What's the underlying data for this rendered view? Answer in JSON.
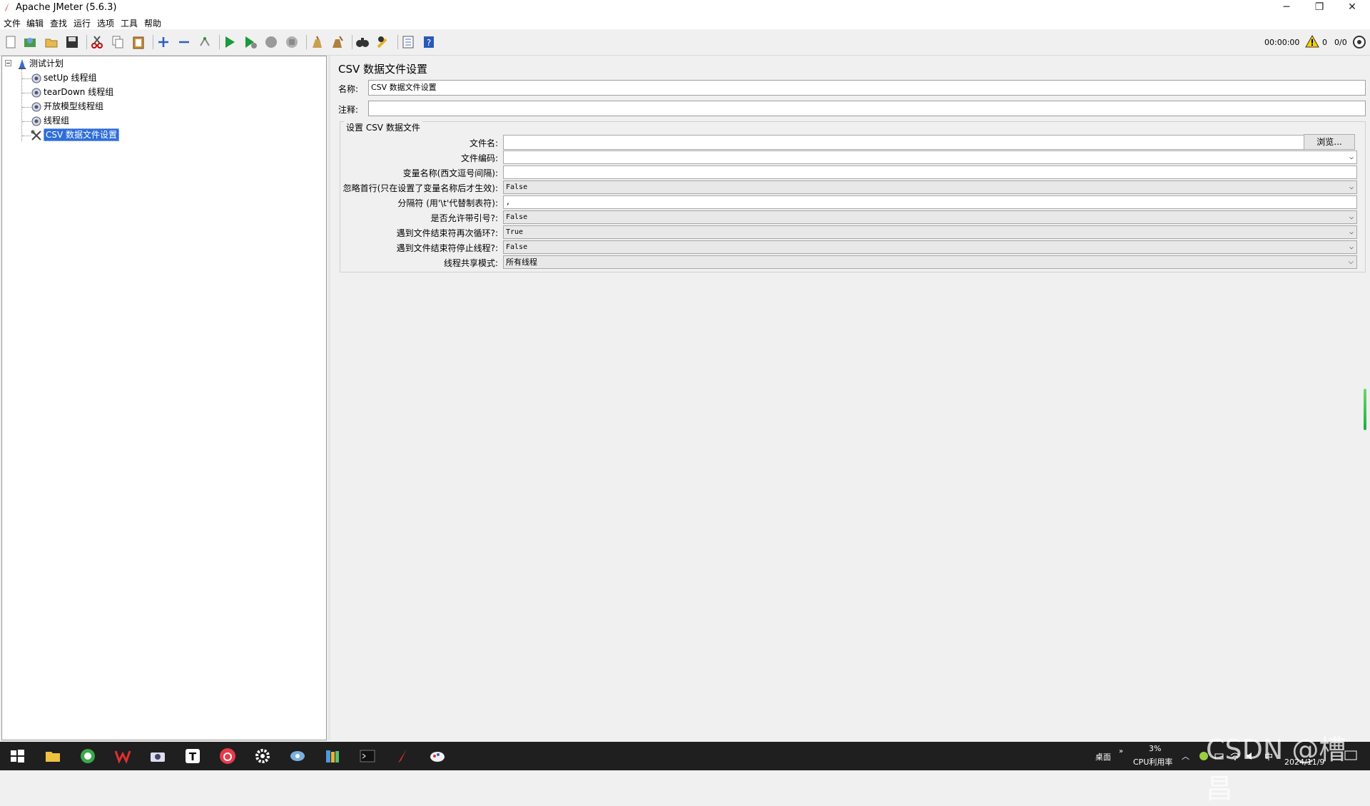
{
  "window": {
    "title": "Apache JMeter (5.6.3)",
    "minimize": "─",
    "maximize": "❐",
    "close": "✕"
  },
  "menu": [
    "文件",
    "编辑",
    "查找",
    "运行",
    "选项",
    "工具",
    "帮助"
  ],
  "status": {
    "elapsed": "00:00:00",
    "warnings": "0",
    "threads": "0/0"
  },
  "tree": {
    "root": "测试计划",
    "children": [
      "setUp 线程组",
      "tearDown 线程组",
      "开放模型线程组",
      "线程组",
      "CSV 数据文件设置"
    ],
    "selected_index": 4
  },
  "panel": {
    "title": "CSV 数据文件设置",
    "name_label": "名称:",
    "name_value": "CSV 数据文件设置",
    "comment_label": "注释:",
    "comment_value": "",
    "group_title": "设置 CSV 数据文件",
    "browse_label": "浏览...",
    "rows": [
      {
        "label": "文件名:",
        "value": "",
        "kind": "text"
      },
      {
        "label": "文件编码:",
        "value": "",
        "kind": "combo"
      },
      {
        "label": "变量名称(西文逗号间隔):",
        "value": "",
        "kind": "text"
      },
      {
        "label": "忽略首行(只在设置了变量名称后才生效):",
        "value": "False",
        "kind": "combo"
      },
      {
        "label": "分隔符 (用'\\t'代替制表符):",
        "value": ",",
        "kind": "text"
      },
      {
        "label": "是否允许带引号?:",
        "value": "False",
        "kind": "combo"
      },
      {
        "label": "遇到文件结束符再次循环?:",
        "value": "True",
        "kind": "combo"
      },
      {
        "label": "遇到文件结束符停止线程?:",
        "value": "False",
        "kind": "combo"
      },
      {
        "label": "线程共享模式:",
        "value": "所有线程",
        "kind": "combo"
      }
    ]
  },
  "taskbar": {
    "desktop_label": "桌面",
    "cpu_percent": "3%",
    "cpu_label": "CPU利用率",
    "ime": "中",
    "date": "2024/11/9",
    "watermark": "CSDN @槽昌"
  },
  "colors": {
    "selection": "#2f6ed8",
    "taskbar": "#1f1f1f"
  }
}
